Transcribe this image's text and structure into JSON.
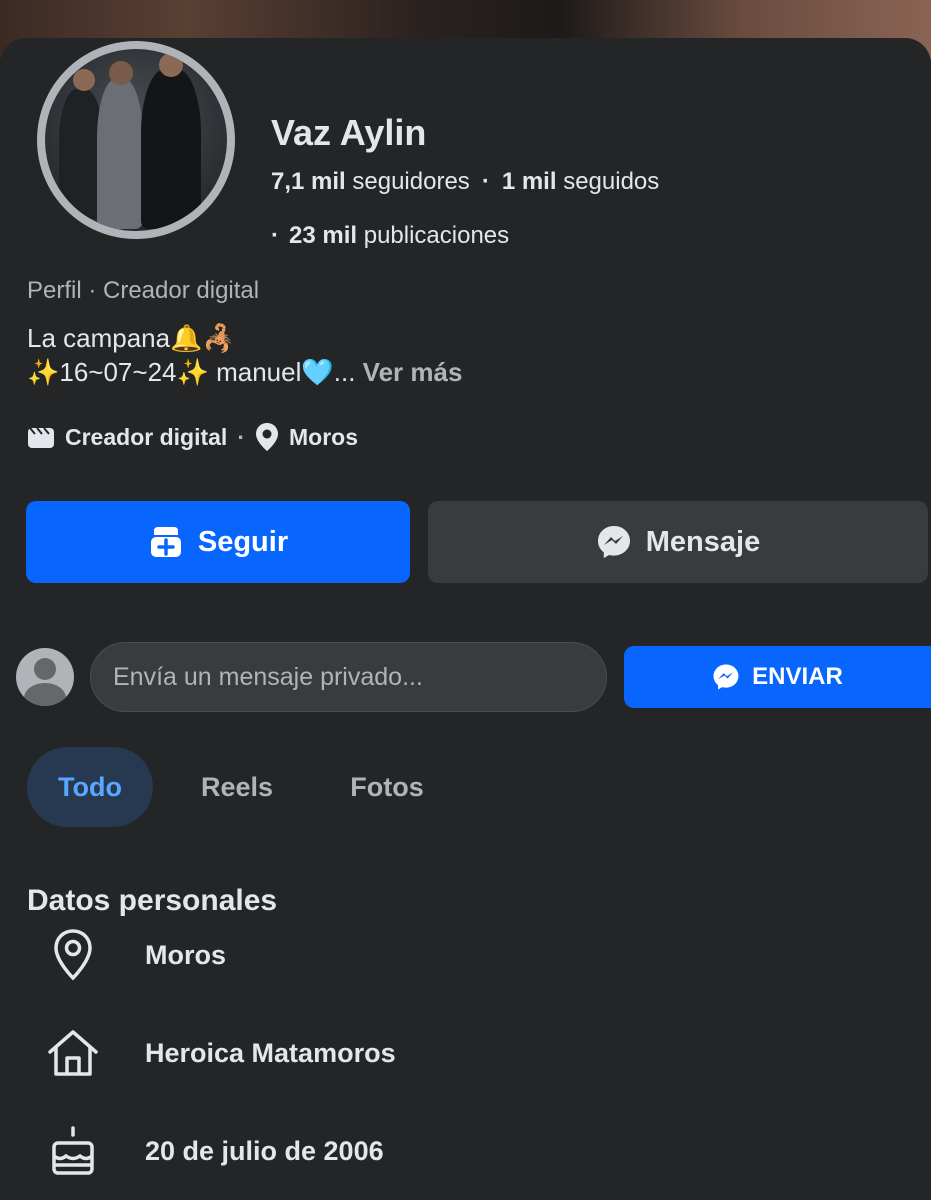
{
  "profile": {
    "name": "Vaz Aylin",
    "followers_count": "7,1 mil",
    "followers_label": "seguidores",
    "following_count": "1 mil",
    "following_label": "seguidos",
    "posts_count": "23 mil",
    "posts_label": "publicaciones",
    "category_line": "Perfil · Creador digital",
    "bio_line1": "La campana🔔🦂",
    "bio_line2": "✨16~07~24✨ manuel🩵...",
    "see_more": "Ver más",
    "meta_category": "Creador digital",
    "meta_location": "Moros"
  },
  "actions": {
    "follow_label": "Seguir",
    "message_label": "Mensaje"
  },
  "private_message": {
    "placeholder": "Envía un mensaje privado...",
    "send_label": "ENVIAR"
  },
  "tabs": [
    {
      "label": "Todo",
      "active": true
    },
    {
      "label": "Reels",
      "active": false
    },
    {
      "label": "Fotos",
      "active": false
    }
  ],
  "personal": {
    "title": "Datos personales",
    "items": [
      {
        "icon": "location-pin-icon",
        "text": "Moros"
      },
      {
        "icon": "home-icon",
        "text": "Heroica Matamoros"
      },
      {
        "icon": "birthday-cake-icon",
        "text": "20 de julio de 2006"
      }
    ]
  },
  "colors": {
    "background": "#242526",
    "primary_blue": "#0866ff",
    "secondary_button": "#3a3b3c",
    "active_tab_bg": "#263951",
    "active_tab_text": "#5aa7ff",
    "muted_text": "#b0b3b8"
  }
}
